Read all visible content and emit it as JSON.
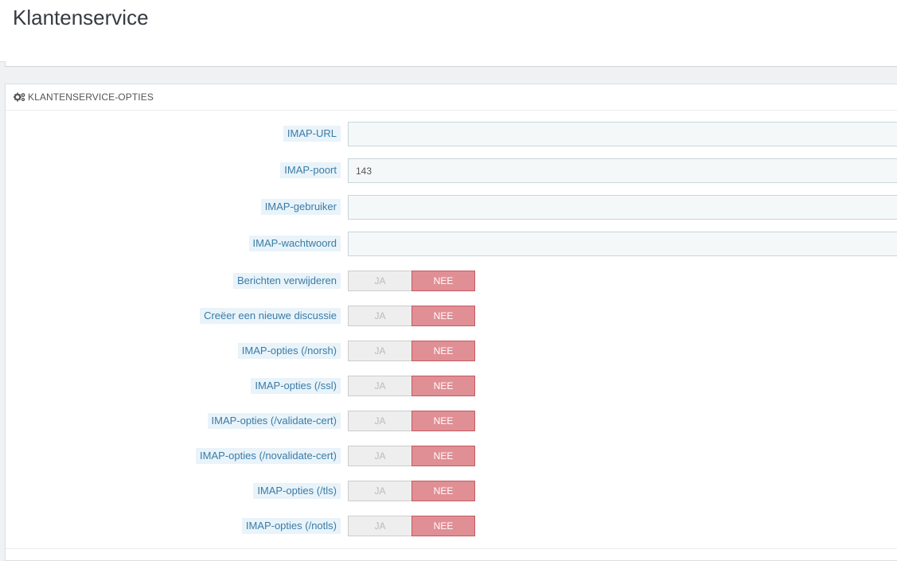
{
  "page": {
    "title": "Klantenservice"
  },
  "panel": {
    "heading": "KLANTENSERVICE-OPTIES",
    "heading_icon": "cogs-icon"
  },
  "fields": [
    {
      "label": "IMAP-URL",
      "value": ""
    },
    {
      "label": "IMAP-poort",
      "value": "143"
    },
    {
      "label": "IMAP-gebruiker",
      "value": ""
    },
    {
      "label": "IMAP-wachtwoord",
      "value": ""
    }
  ],
  "switches": [
    {
      "label": "Berichten verwijderen",
      "yes": "JA",
      "no": "NEE",
      "selected": "NEE"
    },
    {
      "label": "Creëer een nieuwe discussie",
      "yes": "JA",
      "no": "NEE",
      "selected": "NEE"
    },
    {
      "label": "IMAP-opties (/norsh)",
      "yes": "JA",
      "no": "NEE",
      "selected": "NEE"
    },
    {
      "label": "IMAP-opties (/ssl)",
      "yes": "JA",
      "no": "NEE",
      "selected": "NEE"
    },
    {
      "label": "IMAP-opties (/validate-cert)",
      "yes": "JA",
      "no": "NEE",
      "selected": "NEE"
    },
    {
      "label": "IMAP-opties (/novalidate-cert)",
      "yes": "JA",
      "no": "NEE",
      "selected": "NEE"
    },
    {
      "label": "IMAP-opties (/tls)",
      "yes": "JA",
      "no": "NEE",
      "selected": "NEE"
    },
    {
      "label": "IMAP-opties (/notls)",
      "yes": "JA",
      "no": "NEE",
      "selected": "NEE"
    }
  ],
  "colors": {
    "label_bg": "#e9f3fa",
    "label_text": "#3a7ca5",
    "no_active": "#e08f95",
    "yes_inactive": "#eeeeee"
  }
}
